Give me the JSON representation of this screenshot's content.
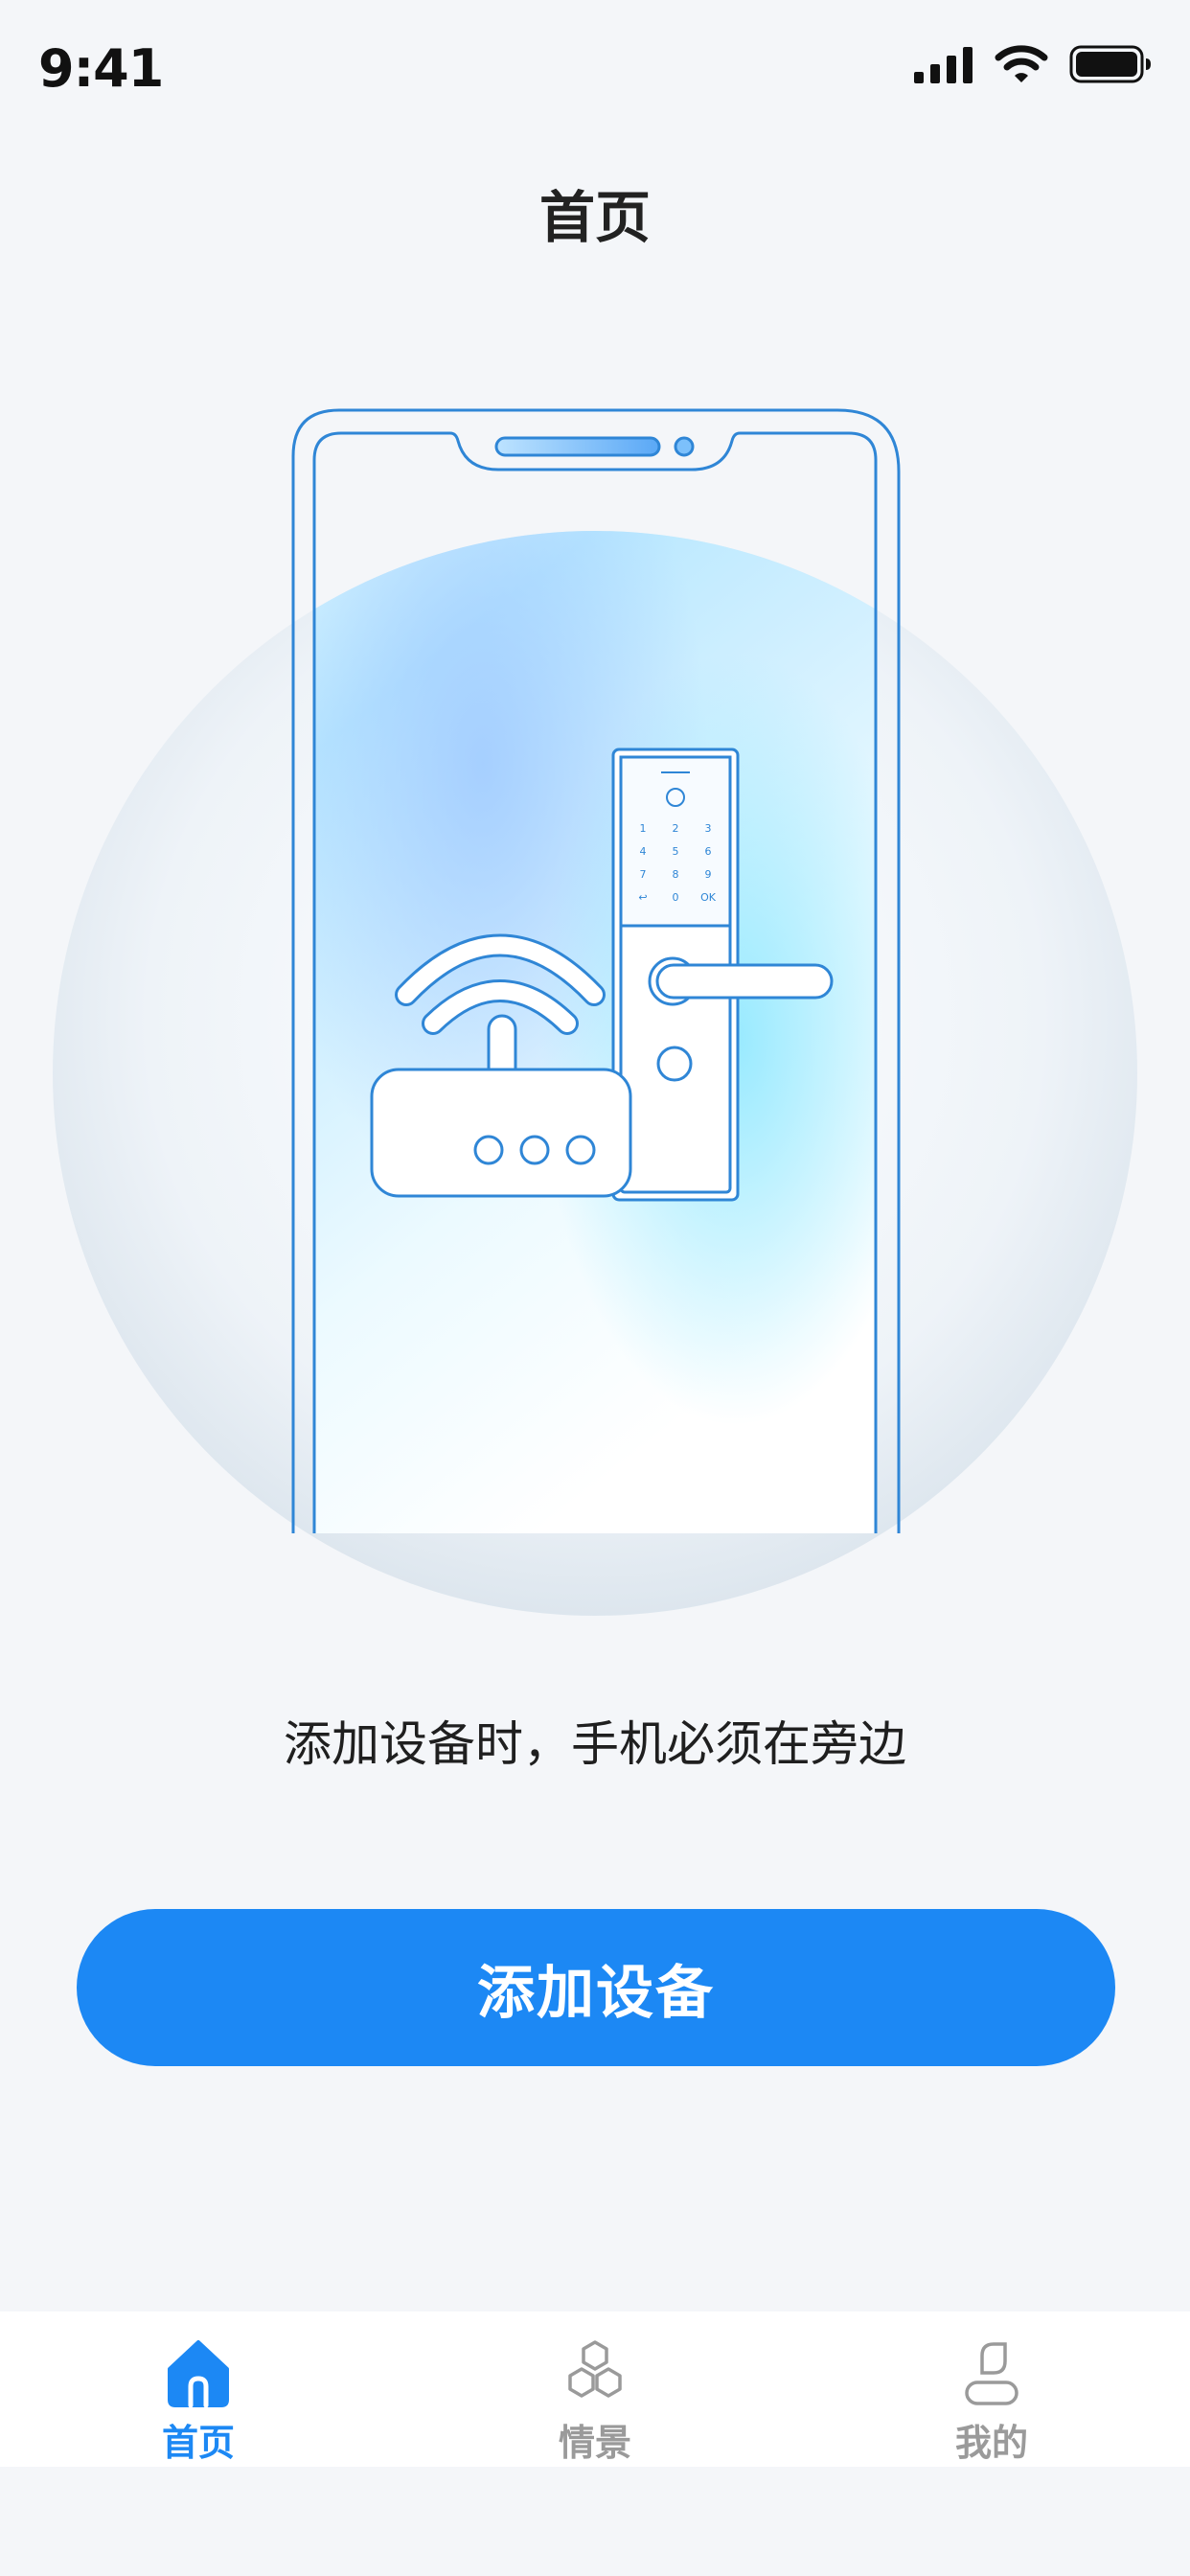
{
  "status_bar": {
    "time": "9:41",
    "icons": [
      "cellular-signal-icon",
      "wifi-icon",
      "battery-icon"
    ]
  },
  "header": {
    "title": "首页"
  },
  "illustration": {
    "icons": [
      "phone-frame-icon",
      "router-icon",
      "smart-lock-icon"
    ],
    "keypad": [
      "1",
      "2",
      "3",
      "4",
      "5",
      "6",
      "7",
      "8",
      "9",
      "↩",
      "0",
      "OK"
    ]
  },
  "hint": "添加设备时，手机必须在旁边",
  "primary_button": {
    "label": "添加设备",
    "color": "#1c88f4"
  },
  "tab_bar": {
    "active_index": 0,
    "active_color": "#1c88f4",
    "inactive_color": "#9a9a9a",
    "items": [
      {
        "label": "首页",
        "icon": "home-icon"
      },
      {
        "label": "情景",
        "icon": "scene-icon"
      },
      {
        "label": "我的",
        "icon": "profile-icon"
      }
    ]
  }
}
